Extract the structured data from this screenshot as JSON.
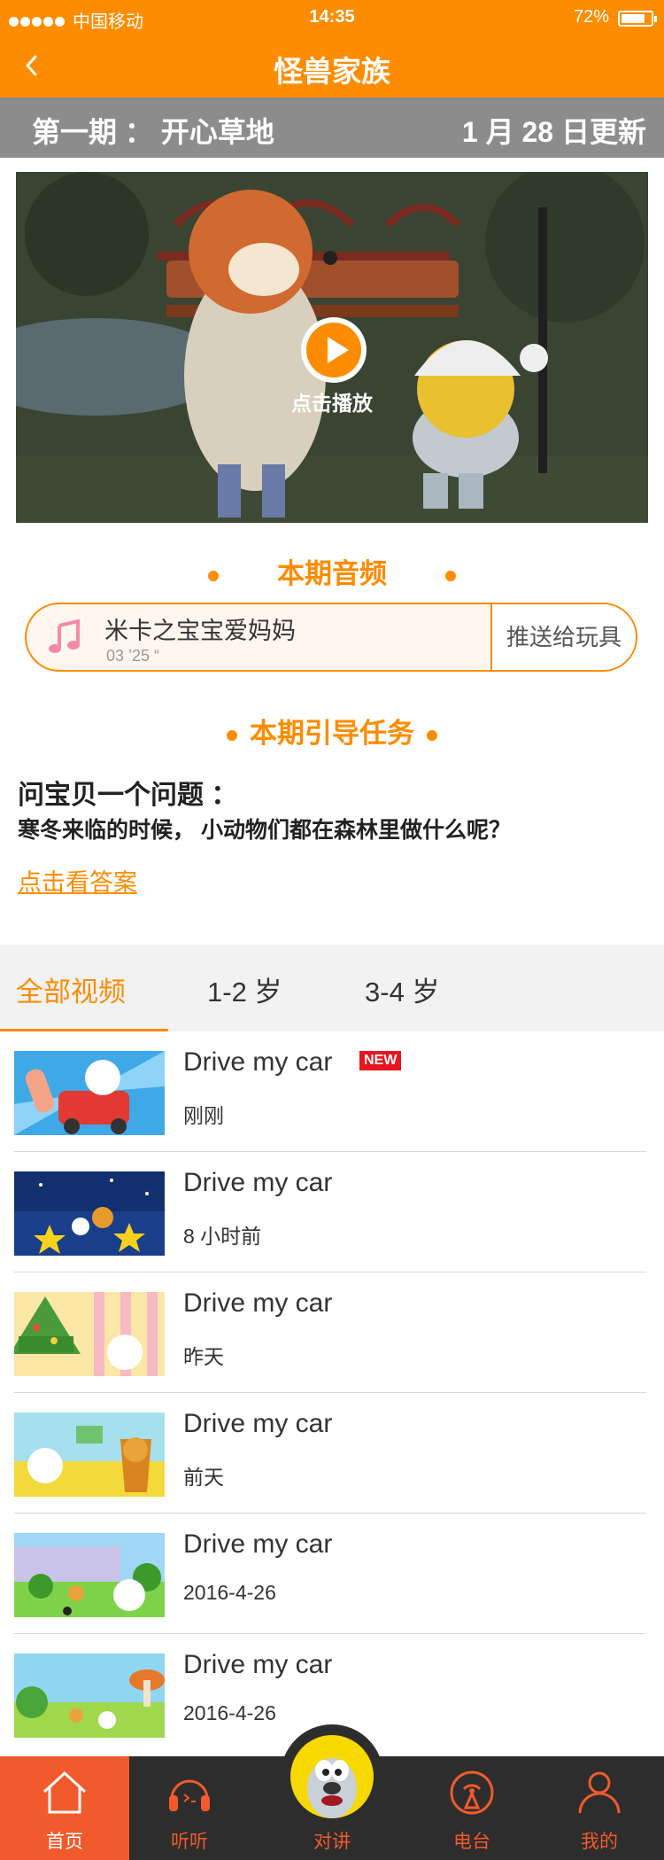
{
  "status_bar": {
    "carrier": "中国移动",
    "time": "14:35",
    "battery": "72%"
  },
  "nav": {
    "title": "怪兽家族"
  },
  "episode": {
    "name": "第一期 ： 开心草地",
    "updated": "1 月 28 日更新"
  },
  "video": {
    "play_label": "点击播放"
  },
  "audio_section": {
    "title": "本期音频",
    "song": "米卡之宝宝爱妈妈",
    "duration": "03 ’25 “",
    "push_label": "推送给玩具"
  },
  "task_section": {
    "title": "本期引导任务",
    "question": "问宝贝一个问题 ：",
    "body": "寒冬来临的时候， 小动物们都在森林里做什么呢？",
    "answer_link": "点击看答案"
  },
  "tabs": [
    {
      "label": "全部视频",
      "active": true
    },
    {
      "label": "1-2 岁",
      "active": false
    },
    {
      "label": "3-4 岁",
      "active": false
    }
  ],
  "videos": [
    {
      "title": "Drive my car",
      "time": "刚刚",
      "badge": "NEW"
    },
    {
      "title": "Drive my car",
      "time": "8 小时前"
    },
    {
      "title": "Drive my car",
      "time": "昨天"
    },
    {
      "title": "Drive my car",
      "time": "前天"
    },
    {
      "title": "Drive my car",
      "time": "2016-4-26"
    },
    {
      "title": "Drive my car",
      "time": "2016-4-26"
    }
  ],
  "bottom_nav": {
    "home": "首页",
    "listen": "听听",
    "talk": "对讲",
    "radio": "电台",
    "mine": "我的"
  },
  "colors": {
    "accent": "#fe8c00",
    "tab_active_bg": "#f15a2c",
    "bar_bg": "#2d2d2d",
    "badge": "#e8151e"
  }
}
